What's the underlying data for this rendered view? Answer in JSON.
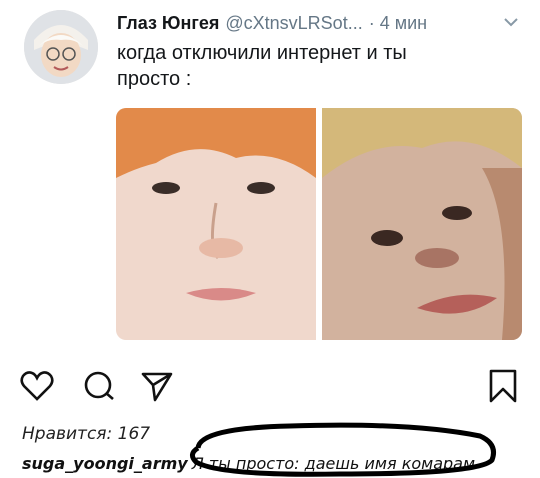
{
  "tweet": {
    "author_name": "Глаз Юнгея",
    "author_handle": "@cXtnsvLRSot...",
    "time": "· 4 мин",
    "text": "когда отключили интернет и ты просто :"
  },
  "post": {
    "likes": "Нравится: 167",
    "username": "suga_yoongi_army",
    "caption": "Л ты просто: даешь имя комарам"
  },
  "icons": {
    "like": "heart-icon",
    "comment": "comment-bubble-icon",
    "share": "direct-share-icon",
    "save": "bookmark-icon",
    "menu": "chevron-down-icon"
  },
  "colors": {
    "text": "#14171a",
    "secondary": "#657786",
    "highlight_circle": "#000000"
  }
}
